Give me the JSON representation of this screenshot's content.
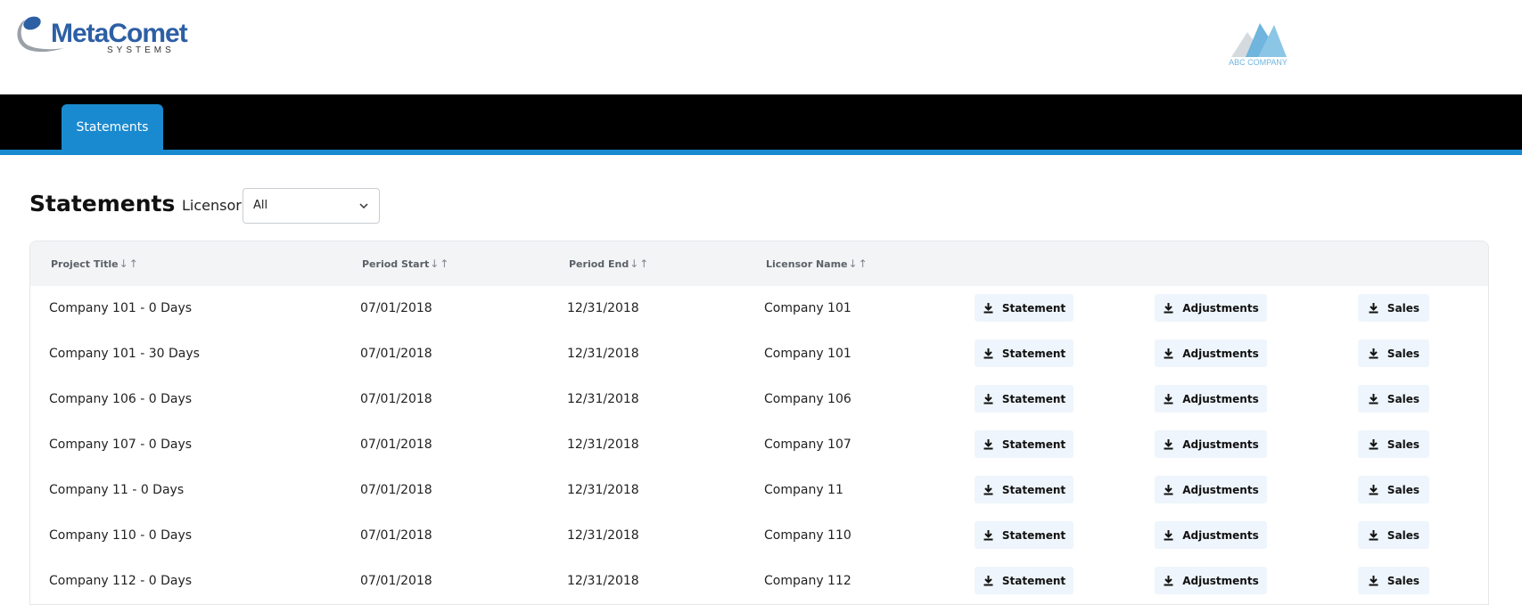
{
  "header": {
    "brand_name": "MetaComet",
    "brand_sub": "SYSTEMS",
    "company_name": "ABC COMPANY"
  },
  "nav": {
    "tabs": [
      {
        "label": "Statements",
        "active": true
      }
    ]
  },
  "page": {
    "title": "Statements",
    "filter": {
      "label": "Licensor",
      "selected": "All"
    }
  },
  "table": {
    "columns": [
      {
        "label": "Project Title",
        "sort": "↓↑"
      },
      {
        "label": "Period Start",
        "sort": "↓↑"
      },
      {
        "label": "Period End",
        "sort": "↓↑"
      },
      {
        "label": "Licensor Name",
        "sort": "↓↑"
      }
    ],
    "actions": [
      "Statement",
      "Adjustments",
      "Sales"
    ],
    "rows": [
      {
        "project": "Company 101 - 0 Days",
        "start": "07/01/2018",
        "end": "12/31/2018",
        "licensor": "Company 101"
      },
      {
        "project": "Company 101 - 30 Days",
        "start": "07/01/2018",
        "end": "12/31/2018",
        "licensor": "Company 101"
      },
      {
        "project": "Company 106 - 0 Days",
        "start": "07/01/2018",
        "end": "12/31/2018",
        "licensor": "Company 106"
      },
      {
        "project": "Company 107 - 0 Days",
        "start": "07/01/2018",
        "end": "12/31/2018",
        "licensor": "Company 107"
      },
      {
        "project": "Company 11 - 0 Days",
        "start": "07/01/2018",
        "end": "12/31/2018",
        "licensor": "Company 11"
      },
      {
        "project": "Company 110 - 0 Days",
        "start": "07/01/2018",
        "end": "12/31/2018",
        "licensor": "Company 110"
      },
      {
        "project": "Company 112 - 0 Days",
        "start": "07/01/2018",
        "end": "12/31/2018",
        "licensor": "Company 112"
      }
    ]
  },
  "colors": {
    "accent": "#1a8ad0",
    "navbar": "#000000",
    "brand_blue": "#2d5fa5",
    "button_bg": "#eef5fc",
    "header_row_bg": "#f3f4f6"
  },
  "icons": {
    "download": "download-icon",
    "chevron": "chevron-down-icon",
    "logo": "comet-logo-icon"
  }
}
